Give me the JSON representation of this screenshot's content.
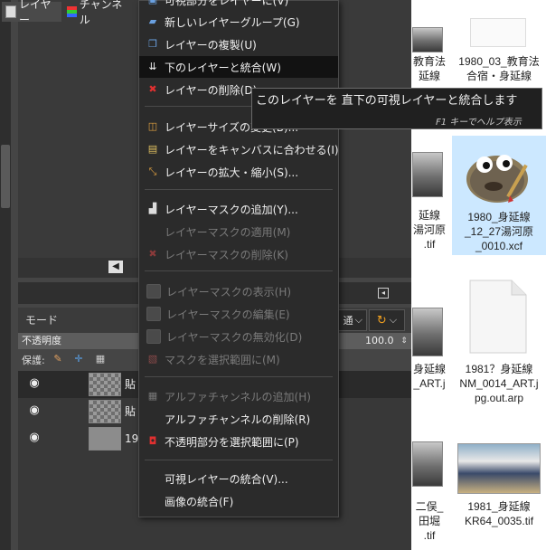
{
  "context_menu": {
    "items": [
      {
        "label": "可視部分をレイヤーに(V)",
        "enabled": true,
        "icon": "visible-to-layer-icon"
      },
      {
        "label": "新しいレイヤーグループ(G)",
        "enabled": true,
        "icon": "new-layer-group-icon"
      },
      {
        "label": "レイヤーの複製(U)",
        "enabled": true,
        "icon": "duplicate-layer-icon"
      },
      {
        "label": "下のレイヤーと統合(W)",
        "enabled": true,
        "icon": "merge-down-icon",
        "highlighted": true
      },
      {
        "label": "レイヤーの削除(D)",
        "enabled": true,
        "icon": "delete-layer-icon"
      },
      {
        "label": "レイヤーサイズの変更(B)...",
        "enabled": true,
        "icon": "layer-boundary-size-icon"
      },
      {
        "label": "レイヤーをキャンバスに合わせる(I)",
        "enabled": true,
        "icon": "layer-to-image-size-icon"
      },
      {
        "label": "レイヤーの拡大・縮小(S)...",
        "enabled": true,
        "icon": "scale-layer-icon"
      },
      {
        "label": "レイヤーマスクの追加(Y)...",
        "enabled": true,
        "icon": "add-layer-mask-icon"
      },
      {
        "label": "レイヤーマスクの適用(M)",
        "enabled": false,
        "icon": ""
      },
      {
        "label": "レイヤーマスクの削除(K)",
        "enabled": false,
        "icon": "delete-mask-icon"
      },
      {
        "label": "レイヤーマスクの表示(H)",
        "enabled": false,
        "icon": "checkbox-icon"
      },
      {
        "label": "レイヤーマスクの編集(E)",
        "enabled": false,
        "icon": "checkbox-icon"
      },
      {
        "label": "レイヤーマスクの無効化(D)",
        "enabled": false,
        "icon": "checkbox-icon"
      },
      {
        "label": "マスクを選択範囲に(M)",
        "enabled": false,
        "icon": "mask-to-selection-icon"
      },
      {
        "label": "アルファチャンネルの追加(H)",
        "enabled": false,
        "icon": "add-alpha-icon"
      },
      {
        "label": "アルファチャンネルの削除(R)",
        "enabled": true,
        "icon": ""
      },
      {
        "label": "不透明部分を選択範囲に(P)",
        "enabled": true,
        "icon": "alpha-to-selection-icon"
      },
      {
        "label": "可視レイヤーの統合(V)...",
        "enabled": true,
        "icon": ""
      },
      {
        "label": "画像の統合(F)",
        "enabled": true,
        "icon": ""
      }
    ]
  },
  "tooltip": {
    "text": "このレイヤーを 直下の可視レイヤーと統合します",
    "hint": "F1 キーでヘルプ表示"
  },
  "layers_dock": {
    "tabs": [
      "レイヤー",
      "チャンネル"
    ],
    "mode_label": "モード",
    "mode_value": "通",
    "opacity_label": "不透明度",
    "opacity_value": "100.0",
    "lock_label": "保護:",
    "layers": [
      {
        "name": "貼",
        "visible": true,
        "thumb": "checker"
      },
      {
        "name": "貼",
        "visible": true,
        "thumb": "checker"
      },
      {
        "name": "19",
        "visible": true,
        "thumb": "photo"
      }
    ]
  },
  "explorer": {
    "files": [
      {
        "label": "教育法\n延線",
        "thumb": "photo"
      },
      {
        "label": "1980_03_教育法\n合宿・身延線",
        "thumb": "blank"
      },
      {
        "label": "延線\n湯河原\n.tif",
        "thumb": "photo"
      },
      {
        "label": "1980_身延線\n_12_27湯河原\n_0010.xcf",
        "thumb": "gimp",
        "selected": true
      },
      {
        "label": "身延線\n_ART.j",
        "thumb": "photo"
      },
      {
        "label": "1981？身延線\nNM_0014_ART.j\npg.out.arp",
        "thumb": "document"
      },
      {
        "label": "二俣_\n田堀\n.tif",
        "thumb": "photo"
      },
      {
        "label": "1981_身延線\nKR64_0035.tif",
        "thumb": "photo"
      }
    ]
  },
  "colors": {
    "menu_bg": "#2b2b2b",
    "menu_highlight": "#121212",
    "panel_bg": "#454545",
    "explorer_bg": "#ffffff",
    "selection_bg": "#cce8ff"
  }
}
